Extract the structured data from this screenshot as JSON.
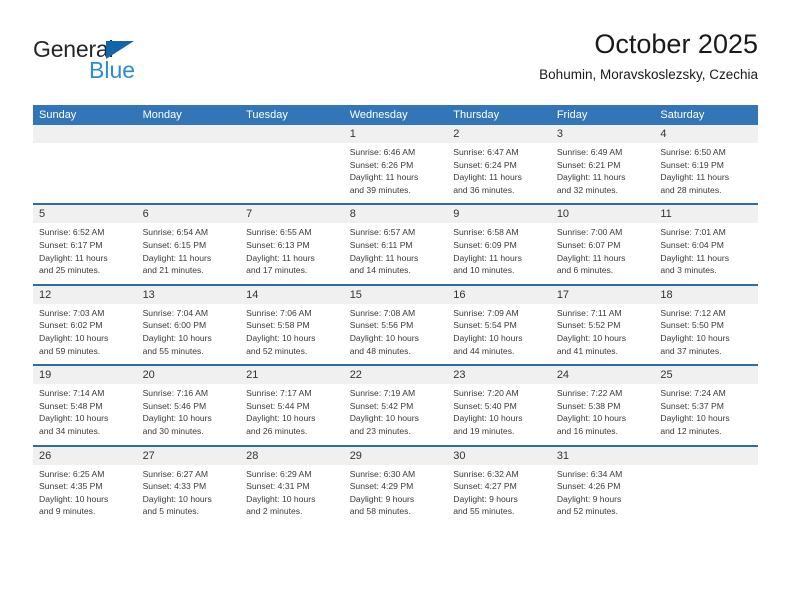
{
  "logo": {
    "word_dark": "General",
    "word_blue": "Blue",
    "triangle_icon": "triangle-icon",
    "colors": {
      "dark": "#262626",
      "blue": "#2e8bd4",
      "triangle": "#1464aa"
    }
  },
  "header": {
    "title": "October 2025",
    "subtitle": "Bohumin, Moravskoslezsky, Czechia"
  },
  "theme": {
    "header_blue": "#3276b8",
    "separator_blue": "#2e6da4",
    "daynum_band": "#f0f0f0",
    "text": "#3a3a3a"
  },
  "weekdays": [
    "Sunday",
    "Monday",
    "Tuesday",
    "Wednesday",
    "Thursday",
    "Friday",
    "Saturday"
  ],
  "weeks": [
    [
      {
        "day": "",
        "sunrise": "",
        "sunset": "",
        "daylight_1": "",
        "daylight_2": ""
      },
      {
        "day": "",
        "sunrise": "",
        "sunset": "",
        "daylight_1": "",
        "daylight_2": ""
      },
      {
        "day": "",
        "sunrise": "",
        "sunset": "",
        "daylight_1": "",
        "daylight_2": ""
      },
      {
        "day": "1",
        "sunrise": "Sunrise: 6:46 AM",
        "sunset": "Sunset: 6:26 PM",
        "daylight_1": "Daylight: 11 hours",
        "daylight_2": "and 39 minutes."
      },
      {
        "day": "2",
        "sunrise": "Sunrise: 6:47 AM",
        "sunset": "Sunset: 6:24 PM",
        "daylight_1": "Daylight: 11 hours",
        "daylight_2": "and 36 minutes."
      },
      {
        "day": "3",
        "sunrise": "Sunrise: 6:49 AM",
        "sunset": "Sunset: 6:21 PM",
        "daylight_1": "Daylight: 11 hours",
        "daylight_2": "and 32 minutes."
      },
      {
        "day": "4",
        "sunrise": "Sunrise: 6:50 AM",
        "sunset": "Sunset: 6:19 PM",
        "daylight_1": "Daylight: 11 hours",
        "daylight_2": "and 28 minutes."
      }
    ],
    [
      {
        "day": "5",
        "sunrise": "Sunrise: 6:52 AM",
        "sunset": "Sunset: 6:17 PM",
        "daylight_1": "Daylight: 11 hours",
        "daylight_2": "and 25 minutes."
      },
      {
        "day": "6",
        "sunrise": "Sunrise: 6:54 AM",
        "sunset": "Sunset: 6:15 PM",
        "daylight_1": "Daylight: 11 hours",
        "daylight_2": "and 21 minutes."
      },
      {
        "day": "7",
        "sunrise": "Sunrise: 6:55 AM",
        "sunset": "Sunset: 6:13 PM",
        "daylight_1": "Daylight: 11 hours",
        "daylight_2": "and 17 minutes."
      },
      {
        "day": "8",
        "sunrise": "Sunrise: 6:57 AM",
        "sunset": "Sunset: 6:11 PM",
        "daylight_1": "Daylight: 11 hours",
        "daylight_2": "and 14 minutes."
      },
      {
        "day": "9",
        "sunrise": "Sunrise: 6:58 AM",
        "sunset": "Sunset: 6:09 PM",
        "daylight_1": "Daylight: 11 hours",
        "daylight_2": "and 10 minutes."
      },
      {
        "day": "10",
        "sunrise": "Sunrise: 7:00 AM",
        "sunset": "Sunset: 6:07 PM",
        "daylight_1": "Daylight: 11 hours",
        "daylight_2": "and 6 minutes."
      },
      {
        "day": "11",
        "sunrise": "Sunrise: 7:01 AM",
        "sunset": "Sunset: 6:04 PM",
        "daylight_1": "Daylight: 11 hours",
        "daylight_2": "and 3 minutes."
      }
    ],
    [
      {
        "day": "12",
        "sunrise": "Sunrise: 7:03 AM",
        "sunset": "Sunset: 6:02 PM",
        "daylight_1": "Daylight: 10 hours",
        "daylight_2": "and 59 minutes."
      },
      {
        "day": "13",
        "sunrise": "Sunrise: 7:04 AM",
        "sunset": "Sunset: 6:00 PM",
        "daylight_1": "Daylight: 10 hours",
        "daylight_2": "and 55 minutes."
      },
      {
        "day": "14",
        "sunrise": "Sunrise: 7:06 AM",
        "sunset": "Sunset: 5:58 PM",
        "daylight_1": "Daylight: 10 hours",
        "daylight_2": "and 52 minutes."
      },
      {
        "day": "15",
        "sunrise": "Sunrise: 7:08 AM",
        "sunset": "Sunset: 5:56 PM",
        "daylight_1": "Daylight: 10 hours",
        "daylight_2": "and 48 minutes."
      },
      {
        "day": "16",
        "sunrise": "Sunrise: 7:09 AM",
        "sunset": "Sunset: 5:54 PM",
        "daylight_1": "Daylight: 10 hours",
        "daylight_2": "and 44 minutes."
      },
      {
        "day": "17",
        "sunrise": "Sunrise: 7:11 AM",
        "sunset": "Sunset: 5:52 PM",
        "daylight_1": "Daylight: 10 hours",
        "daylight_2": "and 41 minutes."
      },
      {
        "day": "18",
        "sunrise": "Sunrise: 7:12 AM",
        "sunset": "Sunset: 5:50 PM",
        "daylight_1": "Daylight: 10 hours",
        "daylight_2": "and 37 minutes."
      }
    ],
    [
      {
        "day": "19",
        "sunrise": "Sunrise: 7:14 AM",
        "sunset": "Sunset: 5:48 PM",
        "daylight_1": "Daylight: 10 hours",
        "daylight_2": "and 34 minutes."
      },
      {
        "day": "20",
        "sunrise": "Sunrise: 7:16 AM",
        "sunset": "Sunset: 5:46 PM",
        "daylight_1": "Daylight: 10 hours",
        "daylight_2": "and 30 minutes."
      },
      {
        "day": "21",
        "sunrise": "Sunrise: 7:17 AM",
        "sunset": "Sunset: 5:44 PM",
        "daylight_1": "Daylight: 10 hours",
        "daylight_2": "and 26 minutes."
      },
      {
        "day": "22",
        "sunrise": "Sunrise: 7:19 AM",
        "sunset": "Sunset: 5:42 PM",
        "daylight_1": "Daylight: 10 hours",
        "daylight_2": "and 23 minutes."
      },
      {
        "day": "23",
        "sunrise": "Sunrise: 7:20 AM",
        "sunset": "Sunset: 5:40 PM",
        "daylight_1": "Daylight: 10 hours",
        "daylight_2": "and 19 minutes."
      },
      {
        "day": "24",
        "sunrise": "Sunrise: 7:22 AM",
        "sunset": "Sunset: 5:38 PM",
        "daylight_1": "Daylight: 10 hours",
        "daylight_2": "and 16 minutes."
      },
      {
        "day": "25",
        "sunrise": "Sunrise: 7:24 AM",
        "sunset": "Sunset: 5:37 PM",
        "daylight_1": "Daylight: 10 hours",
        "daylight_2": "and 12 minutes."
      }
    ],
    [
      {
        "day": "26",
        "sunrise": "Sunrise: 6:25 AM",
        "sunset": "Sunset: 4:35 PM",
        "daylight_1": "Daylight: 10 hours",
        "daylight_2": "and 9 minutes."
      },
      {
        "day": "27",
        "sunrise": "Sunrise: 6:27 AM",
        "sunset": "Sunset: 4:33 PM",
        "daylight_1": "Daylight: 10 hours",
        "daylight_2": "and 5 minutes."
      },
      {
        "day": "28",
        "sunrise": "Sunrise: 6:29 AM",
        "sunset": "Sunset: 4:31 PM",
        "daylight_1": "Daylight: 10 hours",
        "daylight_2": "and 2 minutes."
      },
      {
        "day": "29",
        "sunrise": "Sunrise: 6:30 AM",
        "sunset": "Sunset: 4:29 PM",
        "daylight_1": "Daylight: 9 hours",
        "daylight_2": "and 58 minutes."
      },
      {
        "day": "30",
        "sunrise": "Sunrise: 6:32 AM",
        "sunset": "Sunset: 4:27 PM",
        "daylight_1": "Daylight: 9 hours",
        "daylight_2": "and 55 minutes."
      },
      {
        "day": "31",
        "sunrise": "Sunrise: 6:34 AM",
        "sunset": "Sunset: 4:26 PM",
        "daylight_1": "Daylight: 9 hours",
        "daylight_2": "and 52 minutes."
      },
      {
        "day": "",
        "sunrise": "",
        "sunset": "",
        "daylight_1": "",
        "daylight_2": ""
      }
    ]
  ]
}
